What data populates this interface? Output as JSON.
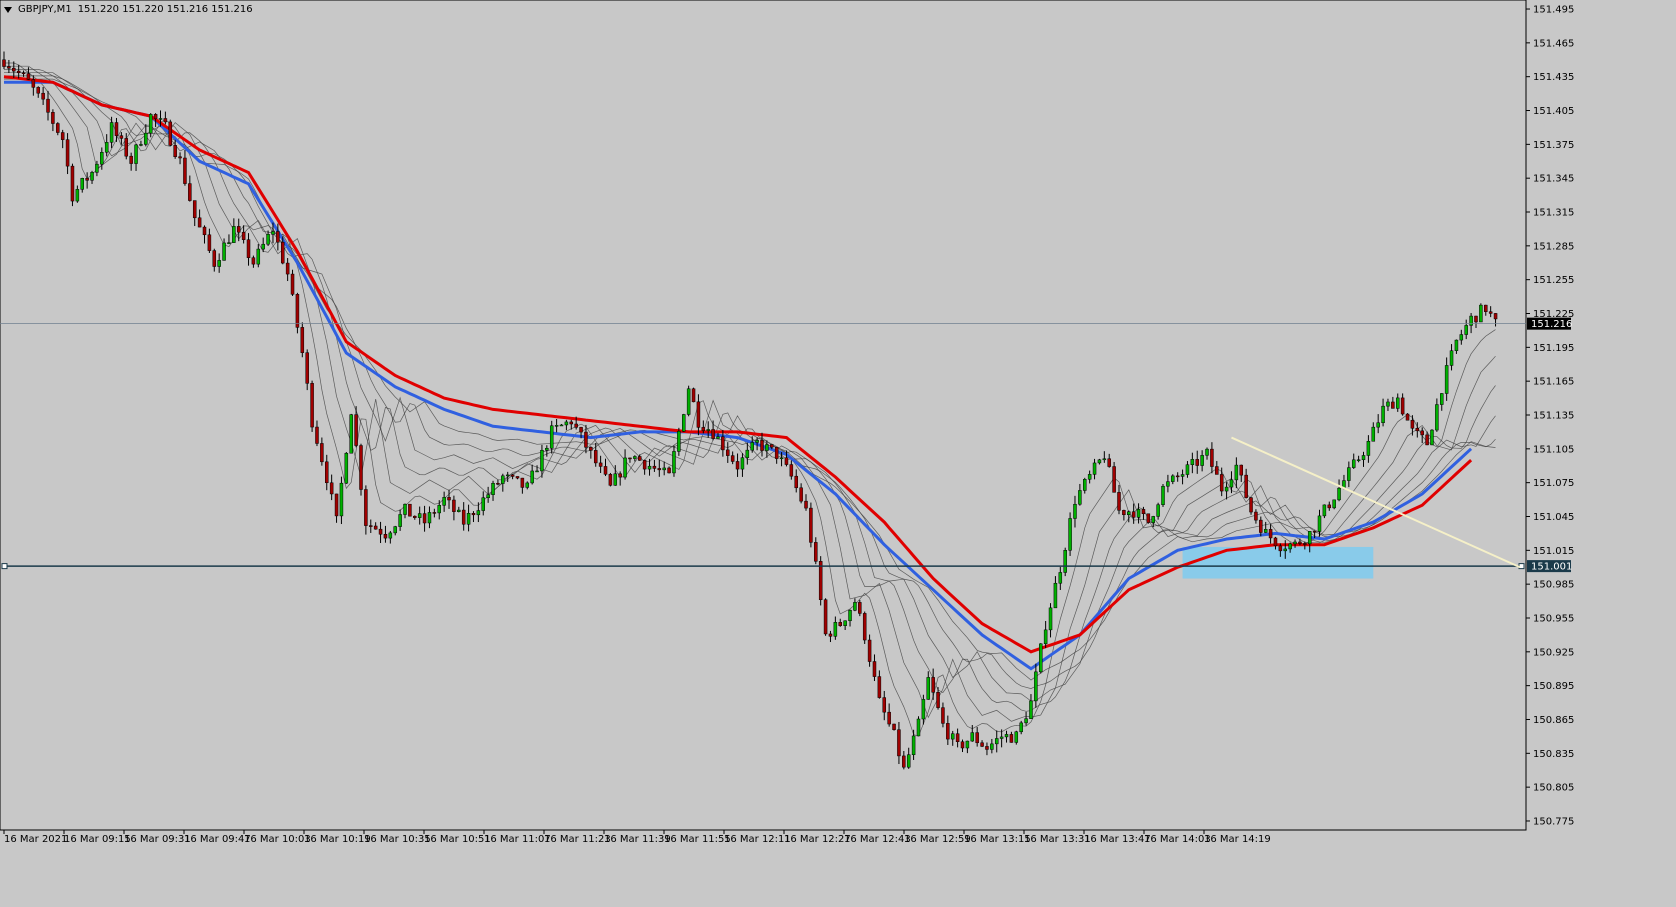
{
  "header": {
    "symbol": "GBPJPY,M1",
    "ohlc": "151.220 151.220 151.216 151.216"
  },
  "colors": {
    "background": "#c8c8c8",
    "bull": "#00b000",
    "bear": "#a00000",
    "ema_fast": "#e00000",
    "ema_slow": "#3060e0",
    "ribbon": "#404040",
    "trendline": "#f5f0c8",
    "zone": "#7ecbf0",
    "level": "#1a3a4a"
  },
  "chart_data": {
    "type": "candlestick",
    "y_ticks": [
      "151.495",
      "151.465",
      "151.435",
      "151.405",
      "151.375",
      "151.345",
      "151.315",
      "151.285",
      "151.255",
      "151.225",
      "151.195",
      "151.165",
      "151.135",
      "151.105",
      "151.075",
      "151.045",
      "151.015",
      "150.985",
      "150.955",
      "150.925",
      "150.895",
      "150.865",
      "150.835",
      "150.805",
      "150.775"
    ],
    "ylim": [
      150.767,
      151.503
    ],
    "x_ticks": [
      "16 Mar 2021",
      "16 Mar 09:15",
      "16 Mar 09:31",
      "16 Mar 09:47",
      "16 Mar 10:03",
      "16 Mar 10:19",
      "16 Mar 10:35",
      "16 Mar 10:51",
      "16 Mar 11:07",
      "16 Mar 11:23",
      "16 Mar 11:39",
      "16 Mar 11:55",
      "16 Mar 12:11",
      "16 Mar 12:27",
      "16 Mar 12:43",
      "16 Mar 12:59",
      "16 Mar 13:15",
      "16 Mar 13:31",
      "16 Mar 13:47",
      "16 Mar 14:03",
      "16 Mar 14:19"
    ],
    "current_price": 151.216,
    "current_price_label": "151.216",
    "level_price": 151.001,
    "level_label": "151.001",
    "close_path": [
      [
        0,
        151.45
      ],
      [
        5,
        151.43
      ],
      [
        8,
        151.41
      ],
      [
        12,
        151.38
      ],
      [
        14,
        151.33
      ],
      [
        18,
        151.35
      ],
      [
        22,
        151.39
      ],
      [
        26,
        151.36
      ],
      [
        30,
        151.4
      ],
      [
        33,
        151.39
      ],
      [
        36,
        151.36
      ],
      [
        39,
        151.31
      ],
      [
        43,
        151.27
      ],
      [
        47,
        151.3
      ],
      [
        51,
        151.27
      ],
      [
        55,
        151.3
      ],
      [
        58,
        151.26
      ],
      [
        61,
        151.19
      ],
      [
        63,
        151.13
      ],
      [
        66,
        151.08
      ],
      [
        68,
        151.04
      ],
      [
        71,
        151.14
      ],
      [
        74,
        151.04
      ],
      [
        78,
        151.03
      ],
      [
        82,
        151.05
      ],
      [
        86,
        151.04
      ],
      [
        90,
        151.06
      ],
      [
        94,
        151.04
      ],
      [
        98,
        151.06
      ],
      [
        102,
        151.08
      ],
      [
        107,
        151.07
      ],
      [
        112,
        151.12
      ],
      [
        116,
        151.13
      ],
      [
        120,
        151.1
      ],
      [
        124,
        151.07
      ],
      [
        128,
        151.1
      ],
      [
        132,
        151.09
      ],
      [
        136,
        151.08
      ],
      [
        140,
        151.16
      ],
      [
        142,
        151.13
      ],
      [
        145,
        151.12
      ],
      [
        150,
        151.09
      ],
      [
        154,
        151.11
      ],
      [
        158,
        151.1
      ],
      [
        161,
        151.08
      ],
      [
        164,
        151.05
      ],
      [
        166,
        151.0
      ],
      [
        168,
        150.94
      ],
      [
        171,
        150.95
      ],
      [
        174,
        150.97
      ],
      [
        176,
        150.94
      ],
      [
        179,
        150.88
      ],
      [
        182,
        150.85
      ],
      [
        184,
        150.82
      ],
      [
        187,
        150.86
      ],
      [
        189,
        150.9
      ],
      [
        192,
        150.86
      ],
      [
        195,
        150.84
      ],
      [
        198,
        150.85
      ],
      [
        201,
        150.84
      ],
      [
        204,
        150.85
      ],
      [
        207,
        150.85
      ],
      [
        210,
        150.88
      ],
      [
        213,
        150.95
      ],
      [
        216,
        151.0
      ],
      [
        219,
        151.06
      ],
      [
        222,
        151.08
      ],
      [
        225,
        151.1
      ],
      [
        228,
        151.05
      ],
      [
        231,
        151.05
      ],
      [
        234,
        151.04
      ],
      [
        237,
        151.07
      ],
      [
        240,
        151.08
      ],
      [
        243,
        151.09
      ],
      [
        246,
        151.1
      ],
      [
        249,
        151.07
      ],
      [
        252,
        151.09
      ],
      [
        255,
        151.05
      ],
      [
        258,
        151.03
      ],
      [
        261,
        151.02
      ],
      [
        264,
        151.02
      ],
      [
        267,
        151.03
      ],
      [
        270,
        151.05
      ],
      [
        273,
        151.07
      ],
      [
        276,
        151.09
      ],
      [
        279,
        151.11
      ],
      [
        282,
        151.14
      ],
      [
        285,
        151.15
      ],
      [
        288,
        151.12
      ],
      [
        291,
        151.11
      ],
      [
        294,
        151.16
      ],
      [
        297,
        151.2
      ],
      [
        300,
        151.22
      ],
      [
        303,
        151.23
      ],
      [
        305,
        151.216
      ]
    ],
    "ema_fast_path": [
      [
        0,
        151.435
      ],
      [
        10,
        151.43
      ],
      [
        20,
        151.41
      ],
      [
        30,
        151.4
      ],
      [
        40,
        151.37
      ],
      [
        50,
        151.35
      ],
      [
        60,
        151.28
      ],
      [
        70,
        151.2
      ],
      [
        80,
        151.17
      ],
      [
        90,
        151.15
      ],
      [
        100,
        151.14
      ],
      [
        110,
        151.135
      ],
      [
        120,
        151.13
      ],
      [
        130,
        151.125
      ],
      [
        140,
        151.12
      ],
      [
        150,
        151.12
      ],
      [
        160,
        151.115
      ],
      [
        170,
        151.08
      ],
      [
        180,
        151.04
      ],
      [
        190,
        150.99
      ],
      [
        200,
        150.95
      ],
      [
        210,
        150.925
      ],
      [
        220,
        150.94
      ],
      [
        230,
        150.98
      ],
      [
        240,
        151.0
      ],
      [
        250,
        151.015
      ],
      [
        260,
        151.02
      ],
      [
        270,
        151.02
      ],
      [
        280,
        151.035
      ],
      [
        290,
        151.055
      ],
      [
        300,
        151.095
      ]
    ],
    "ema_slow_path": [
      [
        0,
        151.43
      ],
      [
        10,
        151.43
      ],
      [
        20,
        151.41
      ],
      [
        30,
        151.4
      ],
      [
        40,
        151.36
      ],
      [
        50,
        151.34
      ],
      [
        60,
        151.27
      ],
      [
        70,
        151.19
      ],
      [
        80,
        151.16
      ],
      [
        90,
        151.14
      ],
      [
        100,
        151.125
      ],
      [
        110,
        151.12
      ],
      [
        120,
        151.115
      ],
      [
        130,
        151.12
      ],
      [
        140,
        151.12
      ],
      [
        150,
        151.115
      ],
      [
        160,
        151.1
      ],
      [
        170,
        151.065
      ],
      [
        180,
        151.02
      ],
      [
        190,
        150.98
      ],
      [
        200,
        150.94
      ],
      [
        210,
        150.91
      ],
      [
        220,
        150.94
      ],
      [
        230,
        150.99
      ],
      [
        240,
        151.015
      ],
      [
        250,
        151.025
      ],
      [
        260,
        151.03
      ],
      [
        270,
        151.025
      ],
      [
        280,
        151.04
      ],
      [
        290,
        151.065
      ],
      [
        300,
        151.105
      ]
    ],
    "trendline": {
      "start": [
        251,
        151.115
      ],
      "end": [
        310,
        151.0
      ]
    },
    "zone": {
      "x_start": 241,
      "x_end": 280,
      "price_low": 150.99,
      "price_high": 151.018
    }
  }
}
